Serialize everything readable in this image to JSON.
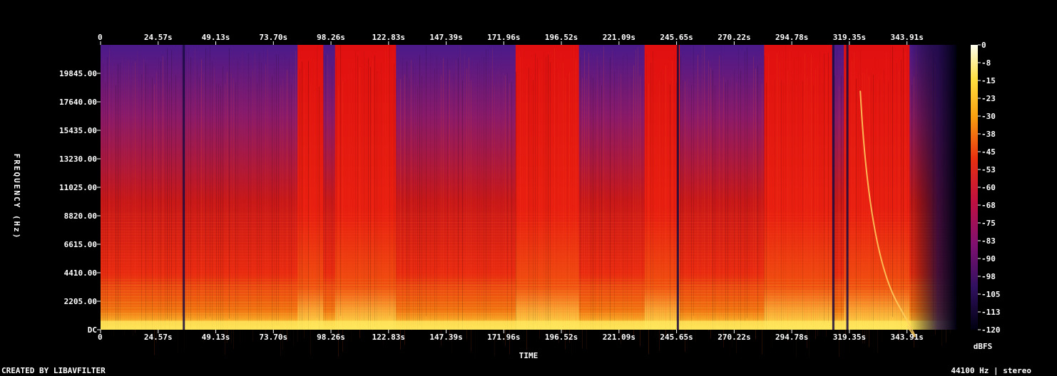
{
  "chart_data": {
    "type": "heatmap",
    "xlabel": "TIME",
    "ylabel": "FREQUENCY (Hz)",
    "x_ticks": [
      "0",
      "24.57s",
      "49.13s",
      "73.70s",
      "98.26s",
      "122.83s",
      "147.39s",
      "171.96s",
      "196.52s",
      "221.09s",
      "245.65s",
      "270.22s",
      "294.78s",
      "319.35s",
      "343.91s"
    ],
    "x_tick_values": [
      0,
      24.57,
      49.13,
      73.7,
      98.26,
      122.83,
      147.39,
      171.96,
      196.52,
      221.09,
      245.65,
      270.22,
      294.78,
      319.35,
      343.91
    ],
    "y_ticks": [
      "DC",
      "2205.00",
      "4410.00",
      "6615.00",
      "8820.00",
      "11025.00",
      "13230.00",
      "15435.00",
      "17640.00",
      "19845.00"
    ],
    "y_tick_values": [
      0,
      2205,
      4410,
      6615,
      8820,
      11025,
      13230,
      15435,
      17640,
      19845
    ],
    "xlim": [
      0,
      365
    ],
    "ylim": [
      0,
      22050
    ],
    "colorbar": {
      "label": "dBFS",
      "ticks": [
        "0",
        "-8",
        "-15",
        "-23",
        "-30",
        "-38",
        "-45",
        "-53",
        "-60",
        "-68",
        "-75",
        "-83",
        "-90",
        "-98",
        "-105",
        "-113",
        "-120"
      ],
      "range": [
        -120,
        0
      ]
    },
    "loud_regions_s": [
      [
        84,
        95
      ],
      [
        100,
        126
      ],
      [
        177,
        204
      ],
      [
        232,
        247
      ],
      [
        283,
        312
      ],
      [
        317,
        345
      ]
    ],
    "quiet_drops_s": [
      35.5,
      246.2,
      312.5,
      318.5
    ],
    "fade_out_start_s": 345
  },
  "footer": {
    "left": "CREATED BY LIBAVFILTER",
    "right": "44100 Hz | stereo"
  },
  "colors": {
    "background": "#000000",
    "text": "#ffffff"
  }
}
